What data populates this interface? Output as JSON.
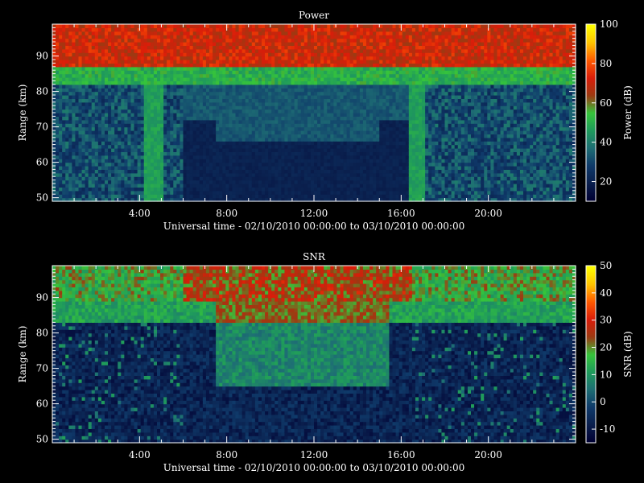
{
  "chart_data": [
    {
      "type": "heatmap",
      "title": "Power",
      "xlabel": "Universal time - 02/10/2010 00:00:00 to 03/10/2010 00:00:00",
      "ylabel": "Range (km)",
      "colorbar_label": "Power (dB)",
      "x_ticks": [
        "4:00",
        "8:00",
        "12:00",
        "16:00",
        "20:00"
      ],
      "x_tick_values_hours": [
        4,
        8,
        12,
        16,
        20
      ],
      "xlim_hours": [
        0,
        24
      ],
      "y_ticks": [
        "50",
        "60",
        "70",
        "80",
        "90"
      ],
      "y_tick_values": [
        50,
        60,
        70,
        80,
        90
      ],
      "ylim": [
        49,
        99
      ],
      "colorbar_ticks": [
        "20",
        "40",
        "60",
        "80",
        "100"
      ],
      "colorbar_tick_values": [
        20,
        40,
        60,
        80,
        100
      ],
      "clim": [
        10,
        100
      ],
      "profile": {
        "description_free": true,
        "upper_layer_value": 64,
        "transition_value": 45,
        "lower_value_night": 28,
        "lower_value_day": 18,
        "bright_columns_hours": [
          [
            4.2,
            5.1
          ],
          [
            16.3,
            17.1
          ]
        ]
      }
    },
    {
      "type": "heatmap",
      "title": "SNR",
      "xlabel": "Universal time - 02/10/2010 00:00:00 to 03/10/2010 00:00:00",
      "ylabel": "Range (km)",
      "colorbar_label": "SNR (dB)",
      "x_ticks": [
        "4:00",
        "8:00",
        "12:00",
        "16:00",
        "20:00"
      ],
      "x_tick_values_hours": [
        4,
        8,
        12,
        16,
        20
      ],
      "xlim_hours": [
        0,
        24
      ],
      "y_ticks": [
        "50",
        "60",
        "70",
        "80",
        "90"
      ],
      "y_tick_values": [
        50,
        60,
        70,
        80,
        90
      ],
      "ylim": [
        49,
        99
      ],
      "colorbar_ticks": [
        "-10",
        "0",
        "10",
        "20",
        "30",
        "40",
        "50"
      ],
      "colorbar_tick_values": [
        -10,
        0,
        10,
        20,
        30,
        40,
        50
      ],
      "clim": [
        -15,
        50
      ]
    }
  ],
  "colors": {
    "background": "#000000",
    "axis": "#ffffff",
    "colormap": [
      "#000033",
      "#0a1f4d",
      "#0f3a6a",
      "#1e6e74",
      "#1f9a5c",
      "#36c43b",
      "#9c3a12",
      "#d91d0a",
      "#ff5a00",
      "#ffc400",
      "#ffff00"
    ]
  }
}
